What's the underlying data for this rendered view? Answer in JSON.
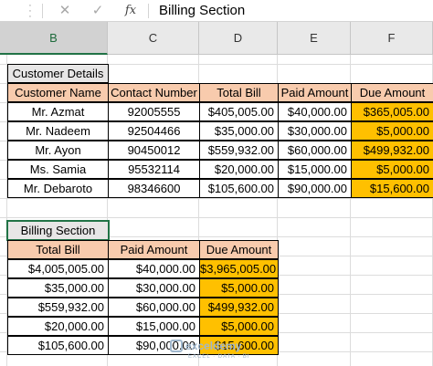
{
  "formula_bar": {
    "cancel_glyph": "✕",
    "enter_glyph": "✓",
    "fx_label": "fx",
    "content": "Billing Section"
  },
  "columns": [
    "B",
    "C",
    "D",
    "E",
    "F"
  ],
  "customer_table": {
    "title": "Customer Details",
    "headers": [
      "Customer Name",
      "Contact Number",
      "Total Bill",
      "Paid Amount",
      "Due Amount"
    ],
    "rows": [
      [
        "Mr. Azmat",
        "92005555",
        "$405,005.00",
        "$40,000.00",
        "$365,005.00"
      ],
      [
        "Mr. Nadeem",
        "92504466",
        "$35,000.00",
        "$30,000.00",
        "$5,000.00"
      ],
      [
        "Mr. Ayon",
        "90450012",
        "$559,932.00",
        "$60,000.00",
        "$499,932.00"
      ],
      [
        "Ms. Samia",
        "95532114",
        "$20,000.00",
        "$15,000.00",
        "$5,000.00"
      ],
      [
        "Mr. Debaroto",
        "98346600",
        "$105,600.00",
        "$90,000.00",
        "$15,600.00"
      ]
    ]
  },
  "billing_table": {
    "title": "Billing Section",
    "headers": [
      "Total Bill",
      "Paid Amount",
      "Due Amount"
    ],
    "rows": [
      [
        "$4,005,005.00",
        "$40,000.00",
        "$3,965,005.00"
      ],
      [
        "$35,000.00",
        "$30,000.00",
        "$5,000.00"
      ],
      [
        "$559,932.00",
        "$60,000.00",
        "$499,932.00"
      ],
      [
        "$20,000.00",
        "$15,000.00",
        "$5,000.00"
      ],
      [
        "$105,600.00",
        "$90,000.00",
        "$15,600.00"
      ]
    ]
  },
  "watermark": {
    "name": "exceldemy",
    "tagline": "EXCEL · DATA · BI"
  },
  "colors": {
    "header_fill": "#f8cbad",
    "title_fill": "#e7e6e6",
    "due_fill": "#ffc000",
    "selection": "#217346"
  }
}
